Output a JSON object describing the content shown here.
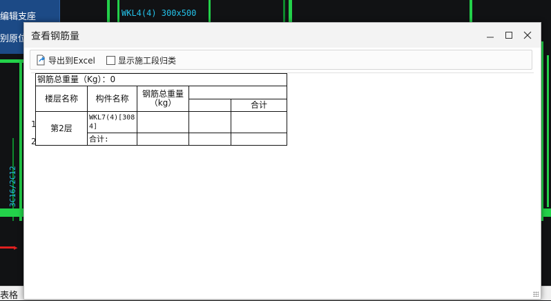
{
  "background": {
    "panel_items": [
      "编辑支座",
      "别原位"
    ],
    "cad_labels": [
      "WKL4(4) 300x500",
      "3C16/2C12"
    ],
    "status_bar_text": "表格"
  },
  "dialog": {
    "title": "查看钢筋量",
    "toolbar": {
      "export_label": "导出到Excel",
      "group_label": "显示施工段归类",
      "group_checked": false
    },
    "sheet": {
      "total_weight": "钢筋总重量（Kg）：0",
      "headers": {
        "floor": "楼层名称",
        "component": "构件名称",
        "weight": "钢筋总重量（kg）",
        "subtotal": "合计"
      },
      "row_numbers": [
        "1",
        "2"
      ],
      "rows": [
        {
          "floor": "第2层",
          "component": "WKL7(4)[3084]"
        },
        {
          "component": "合计:"
        }
      ]
    }
  },
  "colors": {
    "cad_background": "#111214",
    "cad_green": "#23d14a",
    "panel_blue": "#1c4a86",
    "cad_text": "#23c0e8"
  }
}
